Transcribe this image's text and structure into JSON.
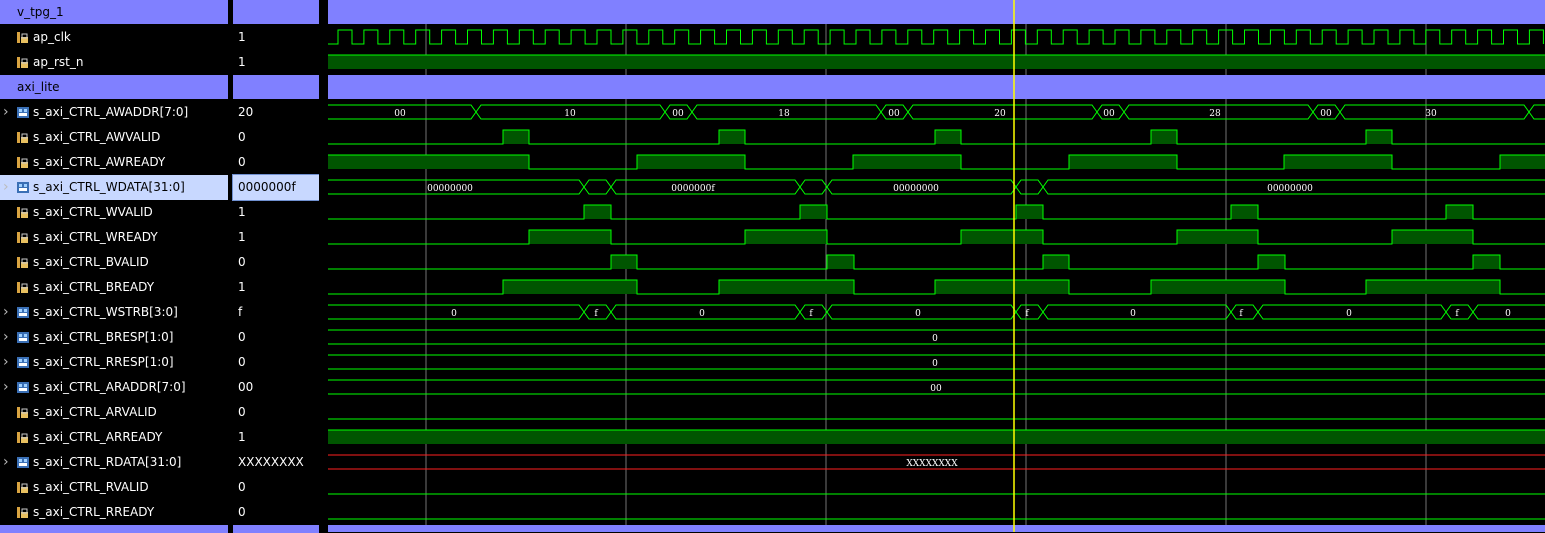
{
  "app": "waveform-viewer",
  "colors": {
    "group_bg": "#8080ff",
    "signal": "#00ff00",
    "signal_fill": "#005500",
    "undefined": "#ff2020",
    "cursor": "#ffff00",
    "grid": "#c0c0c0",
    "selected_row": "#c8d8ff"
  },
  "rows": [
    {
      "kind": "group",
      "label": "v_tpg_1",
      "value": ""
    },
    {
      "kind": "bit",
      "label": "ap_clk",
      "value": "1"
    },
    {
      "kind": "bit",
      "label": "ap_rst_n",
      "value": "1"
    },
    {
      "kind": "group",
      "label": "axi_lite",
      "value": ""
    },
    {
      "kind": "bus",
      "label": "s_axi_CTRL_AWADDR[7:0]",
      "value": "20"
    },
    {
      "kind": "bit",
      "label": "s_axi_CTRL_AWVALID",
      "value": "0"
    },
    {
      "kind": "bit",
      "label": "s_axi_CTRL_AWREADY",
      "value": "0"
    },
    {
      "kind": "bus",
      "label": "s_axi_CTRL_WDATA[31:0]",
      "value": "0000000f",
      "selected": true
    },
    {
      "kind": "bit",
      "label": "s_axi_CTRL_WVALID",
      "value": "1"
    },
    {
      "kind": "bit",
      "label": "s_axi_CTRL_WREADY",
      "value": "1"
    },
    {
      "kind": "bit",
      "label": "s_axi_CTRL_BVALID",
      "value": "0"
    },
    {
      "kind": "bit",
      "label": "s_axi_CTRL_BREADY",
      "value": "1"
    },
    {
      "kind": "bus",
      "label": "s_axi_CTRL_WSTRB[3:0]",
      "value": "f"
    },
    {
      "kind": "bus",
      "label": "s_axi_CTRL_BRESP[1:0]",
      "value": "0"
    },
    {
      "kind": "bus",
      "label": "s_axi_CTRL_RRESP[1:0]",
      "value": "0"
    },
    {
      "kind": "bus",
      "label": "s_axi_CTRL_ARADDR[7:0]",
      "value": "00"
    },
    {
      "kind": "bit",
      "label": "s_axi_CTRL_ARVALID",
      "value": "0"
    },
    {
      "kind": "bit",
      "label": "s_axi_CTRL_ARREADY",
      "value": "1"
    },
    {
      "kind": "bus",
      "label": "s_axi_CTRL_RDATA[31:0]",
      "value": "XXXXXXXX"
    },
    {
      "kind": "bit",
      "label": "s_axi_CTRL_RVALID",
      "value": "0"
    },
    {
      "kind": "bit",
      "label": "s_axi_CTRL_RREADY",
      "value": "0"
    }
  ],
  "waves": {
    "awaddr_values": [
      "00",
      "10",
      "00",
      "18",
      "00",
      "20",
      "00",
      "28",
      "00",
      "30"
    ],
    "wdata_values": [
      "00000000",
      "0000000f",
      "00000000",
      "00000000"
    ],
    "wstrb_values": [
      "0",
      "f",
      "0",
      "f",
      "0",
      "f",
      "0",
      "f",
      "0",
      "f",
      "0"
    ],
    "bresp_value": "0",
    "rresp_value": "0",
    "araddr_value": "00",
    "rdata_value": "XXXXXXXX"
  }
}
